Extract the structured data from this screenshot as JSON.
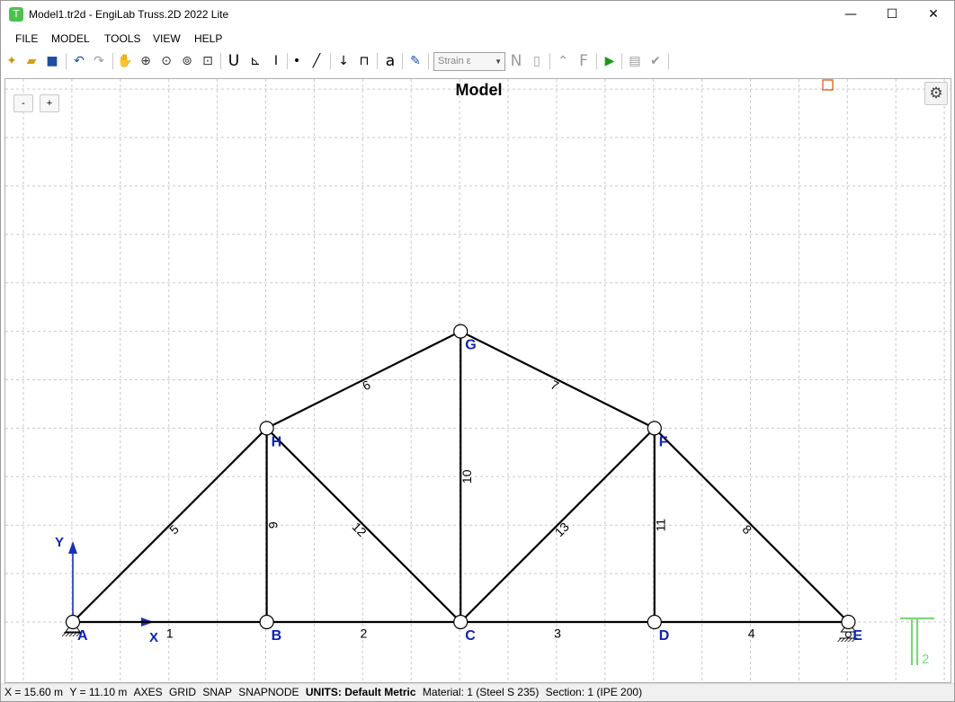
{
  "window": {
    "title": "Model1.tr2d - EngiLab Truss.2D 2022 Lite",
    "minimize": "—",
    "maximize": "☐",
    "close": "✕"
  },
  "menu": [
    "FILE",
    "MODEL",
    "TOOLS",
    "VIEW",
    "HELP"
  ],
  "toolbar": {
    "result_select": "Strain ε",
    "icons": [
      "new-file",
      "open-file",
      "save",
      "undo",
      "redo",
      "pan",
      "zoom-in",
      "zoom-extents",
      "zoom-window",
      "zoom-previous",
      "support",
      "spring-support",
      "section",
      "node",
      "element",
      "point-load",
      "distributed-load",
      "text",
      "edit",
      "strain-selector",
      "N",
      "labels",
      "deformed",
      "F",
      "run",
      "report",
      "check"
    ]
  },
  "canvas": {
    "title": "Model",
    "zoom_out": "-",
    "zoom_in": "+",
    "axis_x": "X",
    "axis_y": "Y",
    "logo": "T2",
    "nodes": [
      {
        "id": "A",
        "x": 0,
        "y": 0
      },
      {
        "id": "B",
        "x": 4,
        "y": 0
      },
      {
        "id": "C",
        "x": 8,
        "y": 0
      },
      {
        "id": "D",
        "x": 12,
        "y": 0
      },
      {
        "id": "E",
        "x": 16,
        "y": 0
      },
      {
        "id": "F",
        "x": 12,
        "y": 4
      },
      {
        "id": "G",
        "x": 8,
        "y": 6
      },
      {
        "id": "H",
        "x": 4,
        "y": 4
      }
    ],
    "elements": [
      {
        "id": "1",
        "from": "A",
        "to": "B"
      },
      {
        "id": "2",
        "from": "B",
        "to": "C"
      },
      {
        "id": "3",
        "from": "C",
        "to": "D"
      },
      {
        "id": "4",
        "from": "D",
        "to": "E"
      },
      {
        "id": "5",
        "from": "A",
        "to": "H"
      },
      {
        "id": "6",
        "from": "H",
        "to": "G"
      },
      {
        "id": "7",
        "from": "G",
        "to": "F"
      },
      {
        "id": "8",
        "from": "F",
        "to": "E"
      },
      {
        "id": "9",
        "from": "B",
        "to": "H"
      },
      {
        "id": "10",
        "from": "C",
        "to": "G"
      },
      {
        "id": "11",
        "from": "D",
        "to": "F"
      },
      {
        "id": "12",
        "from": "H",
        "to": "C"
      },
      {
        "id": "13",
        "from": "C",
        "to": "F"
      }
    ],
    "supports": [
      {
        "node": "A",
        "type": "pin"
      },
      {
        "node": "E",
        "type": "roller"
      }
    ],
    "colors": {
      "label": "#0d24b5",
      "logo": "#7ed67e",
      "grid": "#c9c9c9",
      "member": "#000000"
    }
  },
  "status": {
    "x_coord": "X = 15.60 m",
    "y_coord": "Y = 11.10 m",
    "toggles": [
      "AXES",
      "GRID",
      "SNAP",
      "SNAPNODE"
    ],
    "units": "UNITS: Default Metric",
    "material": "Material: 1 (Steel S 235)",
    "section": "Section: 1 (IPE 200)"
  }
}
